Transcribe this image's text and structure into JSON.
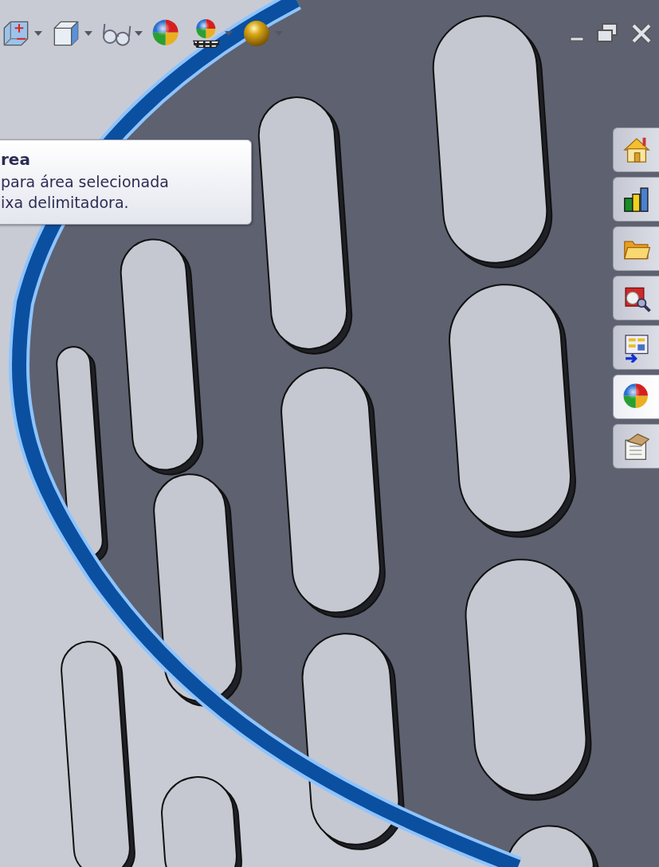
{
  "view_toolbar": {
    "items": [
      {
        "kind": "section-view",
        "dropdown": true
      },
      {
        "kind": "display-style",
        "dropdown": true
      },
      {
        "kind": "hide-show",
        "dropdown": true
      },
      {
        "kind": "appearance",
        "dropdown": false
      },
      {
        "kind": "scene",
        "dropdown": true
      },
      {
        "kind": "render",
        "dropdown": true
      }
    ]
  },
  "tooltip": {
    "title": "rea",
    "lines": [
      "para área selecionada",
      "ixa delimitadora."
    ]
  },
  "task_pane": {
    "tabs": [
      {
        "kind": "home",
        "selected": false
      },
      {
        "kind": "library",
        "selected": false
      },
      {
        "kind": "folder",
        "selected": false
      },
      {
        "kind": "search",
        "selected": false
      },
      {
        "kind": "palette",
        "selected": false
      },
      {
        "kind": "appearance",
        "selected": true
      },
      {
        "kind": "properties",
        "selected": false
      }
    ]
  }
}
